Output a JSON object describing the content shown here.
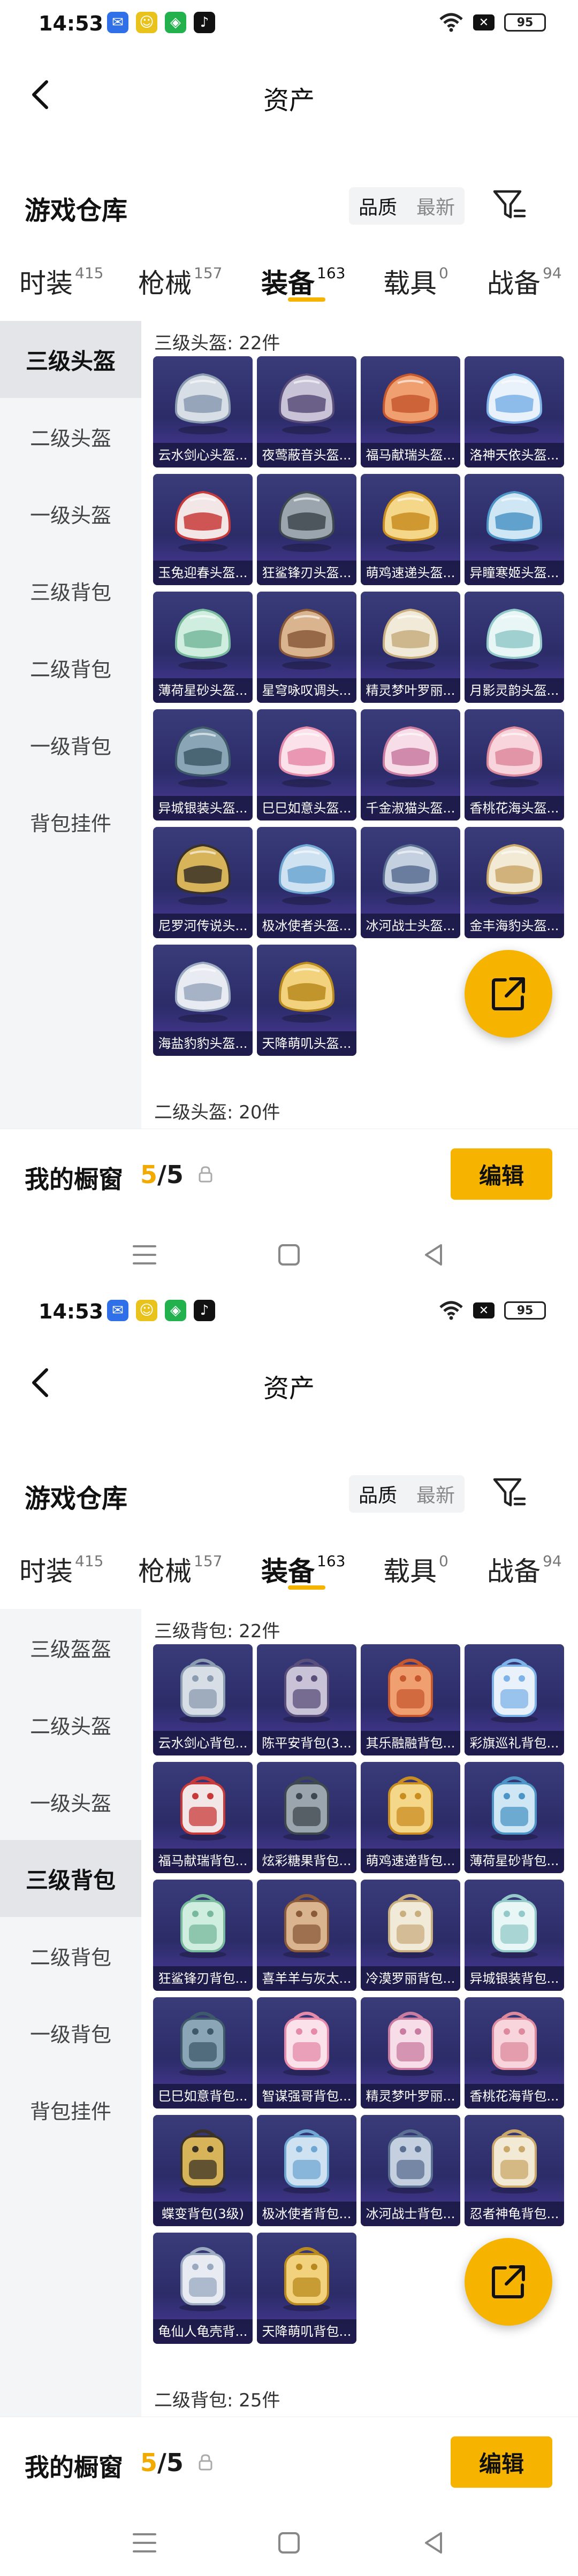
{
  "screens": [
    {
      "status": {
        "time": "14:53",
        "battery": "95"
      },
      "header": {
        "title": "资产"
      },
      "section": {
        "title": "游戏仓库",
        "sort_quality": "品质",
        "sort_newest": "最新"
      },
      "tabs": [
        {
          "label": "时装",
          "count": "415"
        },
        {
          "label": "枪械",
          "count": "157"
        },
        {
          "label": "装备",
          "count": "163"
        },
        {
          "label": "载具",
          "count": "0"
        },
        {
          "label": "战备",
          "count": "94"
        }
      ],
      "sidebar": [
        "三级头盔",
        "二级头盔",
        "一级头盔",
        "三级背包",
        "二级背包",
        "一级背包",
        "背包挂件"
      ],
      "active_side": 0,
      "group_label": "三级头盔: 22件",
      "next_group_label": "二级头盔: 20件",
      "items": [
        "云水剑心头盔...",
        "夜莺蔽音头盔...",
        "福马献瑞头盔...",
        "洛神天依头盔...",
        "玉兔迎春头盔...",
        "狂鲨锋刃头盔...",
        "萌鸡速递头盔...",
        "异瞳寒姬头盔...",
        "薄荷星砂头盔...",
        "星穹咏叹调头...",
        "精灵梦叶罗丽...",
        "月影灵韵头盔...",
        "异城银装头盔...",
        "巳巳如意头盔...",
        "千金淑猫头盔...",
        "香桃花海头盔...",
        "尼罗河传说头...",
        "极冰使者头盔...",
        "冰河战士头盔...",
        "金丰海豹头盔...",
        "海盐豹豹头盔...",
        "天降萌叽头盔..."
      ],
      "showcase": {
        "title": "我的橱窗",
        "used": "5",
        "total": "/5",
        "edit": "编辑"
      }
    },
    {
      "status": {
        "time": "14:53",
        "battery": "95"
      },
      "header": {
        "title": "资产"
      },
      "section": {
        "title": "游戏仓库",
        "sort_quality": "品质",
        "sort_newest": "最新"
      },
      "tabs": [
        {
          "label": "时装",
          "count": "415"
        },
        {
          "label": "枪械",
          "count": "157"
        },
        {
          "label": "装备",
          "count": "163"
        },
        {
          "label": "载具",
          "count": "0"
        },
        {
          "label": "战备",
          "count": "94"
        }
      ],
      "sidebar": [
        "三级盔盔",
        "二级头盔",
        "一级头盔",
        "三级背包",
        "二级背包",
        "一级背包",
        "背包挂件"
      ],
      "active_side": 3,
      "group_label": "三级背包: 22件",
      "next_group_label": "二级背包: 25件",
      "items": [
        "云水剑心背包...",
        "陈平安背包(3...",
        "其乐融融背包...",
        "彩旗巡礼背包...",
        "福马献瑞背包...",
        "炫彩糖果背包...",
        "萌鸡速递背包...",
        "薄荷星砂背包...",
        "狂鲨锋刃背包...",
        "喜羊羊与灰太...",
        "冷漠罗丽背包...",
        "异城银装背包...",
        "巳巳如意背包...",
        "智谋强哥背包...",
        "精灵梦叶罗丽...",
        "香桃花海背包...",
        "蝶变背包(3级)",
        "极冰使者背包...",
        "冰河战士背包...",
        "忍者神龟背包...",
        "龟仙人龟壳背...",
        "天降萌叽背包..."
      ],
      "showcase": {
        "title": "我的橱窗",
        "used": "5",
        "total": "/5",
        "edit": "编辑"
      }
    }
  ]
}
